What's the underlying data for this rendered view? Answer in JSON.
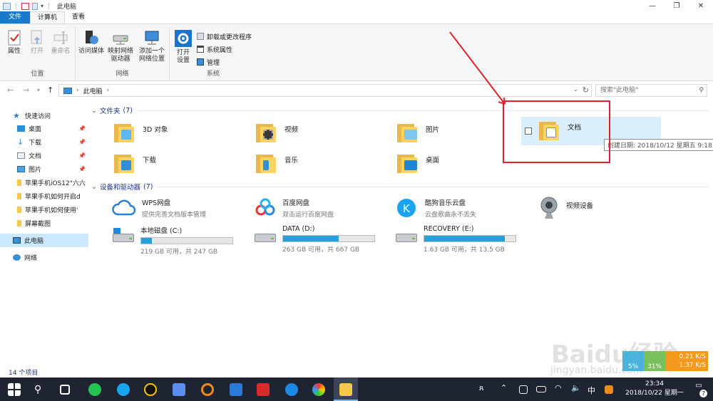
{
  "window": {
    "title": "此电脑",
    "controls": {
      "minimize": "—",
      "maximize": "❐",
      "close": "✕"
    }
  },
  "ribbon": {
    "tabs": [
      "文件",
      "计算机",
      "查看"
    ],
    "groups": {
      "location": {
        "label": "位置",
        "buttons": [
          {
            "label": "属性"
          },
          {
            "label": "打开"
          },
          {
            "label": "重命名"
          }
        ]
      },
      "network": {
        "label": "网络",
        "buttons": [
          {
            "label": "访问媒体"
          },
          {
            "label_line1": "映射网络",
            "label_line2": "驱动器"
          },
          {
            "label_line1": "添加一个",
            "label_line2": "网络位置"
          }
        ]
      },
      "system": {
        "label": "系统",
        "open_settings_line1": "打开",
        "open_settings_line2": "设置",
        "items": [
          "卸载或更改程序",
          "系统属性",
          "管理"
        ]
      }
    }
  },
  "address": {
    "path_root": "此电脑",
    "search_placeholder": "搜索\"此电脑\""
  },
  "nav": {
    "quick_access": "快速访问",
    "items": [
      {
        "label": "桌面",
        "pinned": true
      },
      {
        "label": "下载",
        "pinned": true
      },
      {
        "label": "文档",
        "pinned": true
      },
      {
        "label": "图片",
        "pinned": true
      },
      {
        "label": "苹果手机iOS12\"六六",
        "pinned": false
      },
      {
        "label": "苹果手机如何开启d",
        "pinned": false
      },
      {
        "label": "苹果手机如何使用'",
        "pinned": false
      },
      {
        "label": "屏幕截图",
        "pinned": false
      }
    ],
    "this_pc": "此电脑",
    "network": "网络"
  },
  "content": {
    "folders_header": "文件夹",
    "folders_count": "(7)",
    "folders": [
      "3D 对象",
      "视频",
      "图片",
      "文档",
      "下载",
      "音乐",
      "桌面"
    ],
    "tooltip": "创建日期: 2018/10/12 星期五 9:18",
    "devices_header": "设备和驱动器",
    "devices_count": "(7)",
    "devices": [
      {
        "name": "WPS网盘",
        "sub": "提供完善文档版本管理"
      },
      {
        "name": "百度网盘",
        "sub": "双击运行百度网盘"
      },
      {
        "name": "酷狗音乐云盘",
        "sub": "云盘歌曲永不丢失"
      },
      {
        "name": "视频设备",
        "sub": ""
      }
    ],
    "drives": [
      {
        "name": "本地磁盘 (C:)",
        "size": "219 GB 可用，共 247 GB",
        "used_fraction": 0.12
      },
      {
        "name": "DATA (D:)",
        "size": "263 GB 可用，共 667 GB",
        "used_fraction": 0.61
      },
      {
        "name": "RECOVERY (E:)",
        "size": "1.63 GB 可用，共 13.5 GB",
        "used_fraction": 0.88
      }
    ]
  },
  "status": {
    "items": "14 个项目"
  },
  "overlay": {
    "watermark": "Baidu经验",
    "watermark_sub": "jingyan.baidu.com",
    "netmon": {
      "cpu": "5%",
      "mem": "31%",
      "down": "0.21 K/S",
      "up": "1.37 K/S"
    }
  },
  "taskbar": {
    "ime": "中",
    "time": "23:34",
    "date": "2018/10/22 星期一",
    "notification_count": "7"
  },
  "colors": {
    "accent": "#1979ca",
    "header_text": "#1e3287",
    "selection": "#cce8ff",
    "annotation": "#e0202a",
    "taskbar": "#1f2433"
  }
}
